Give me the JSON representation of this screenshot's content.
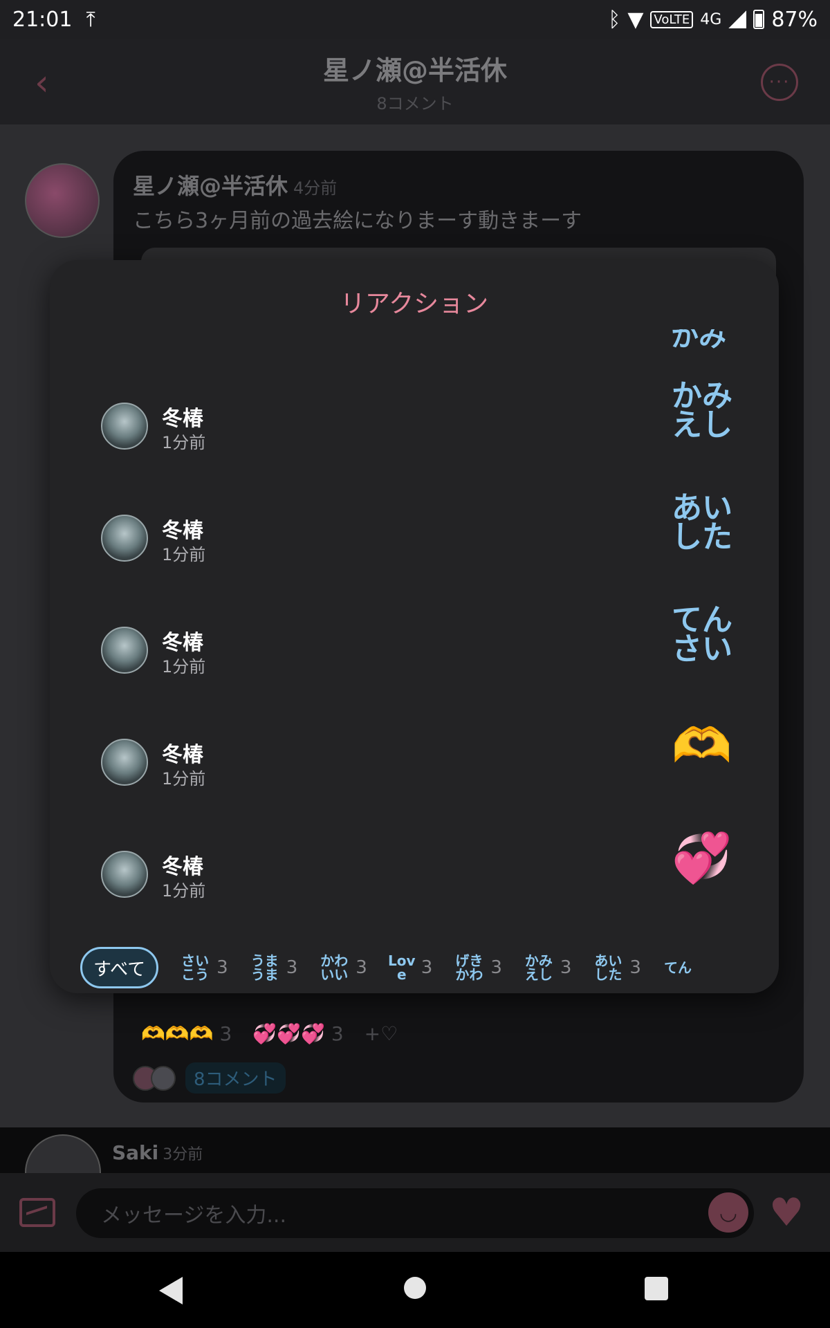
{
  "status_bar": {
    "time": "21:01",
    "volte": "VoLTE",
    "network": "4G",
    "battery": "87%"
  },
  "header": {
    "title": "星ノ瀬@半活休",
    "subtitle": "8コメント"
  },
  "post": {
    "author": "星ノ瀬@半活休",
    "ago": "4分前",
    "text": "こちら3ヶ月前の過去絵になりまーす動きまーす",
    "reaction_counts": [
      "3",
      "3"
    ],
    "comments_chip": "8コメント"
  },
  "next_post": {
    "author": "Saki",
    "ago": "3分前"
  },
  "input": {
    "placeholder": "メッセージを入力..."
  },
  "modal": {
    "title": "リアクション",
    "rows": [
      {
        "name": "冬椿",
        "time": "1分前",
        "reaction": "かみえし",
        "emoji": false
      },
      {
        "name": "冬椿",
        "time": "1分前",
        "reaction": "あいした",
        "emoji": false
      },
      {
        "name": "冬椿",
        "time": "1分前",
        "reaction": "てんさい",
        "emoji": false
      },
      {
        "name": "冬椿",
        "time": "1分前",
        "reaction": "🫶",
        "emoji": true
      },
      {
        "name": "冬椿",
        "time": "1分前",
        "reaction": "💞",
        "emoji": true
      }
    ],
    "tabs": {
      "all": "すべて",
      "items": [
        {
          "label": "さいこう",
          "count": "3"
        },
        {
          "label": "うまうま",
          "count": "3"
        },
        {
          "label": "かわいい",
          "count": "3"
        },
        {
          "label": "Love",
          "count": "3"
        },
        {
          "label": "げきかわ",
          "count": "3"
        },
        {
          "label": "かみえし",
          "count": "3"
        },
        {
          "label": "あいした",
          "count": "3"
        },
        {
          "label": "てん",
          "count": ""
        }
      ]
    }
  },
  "colors": {
    "accent_pink": "#e7889c",
    "reaction_blue": "#8ec8ef",
    "dim_accent": "#6b3a48"
  }
}
